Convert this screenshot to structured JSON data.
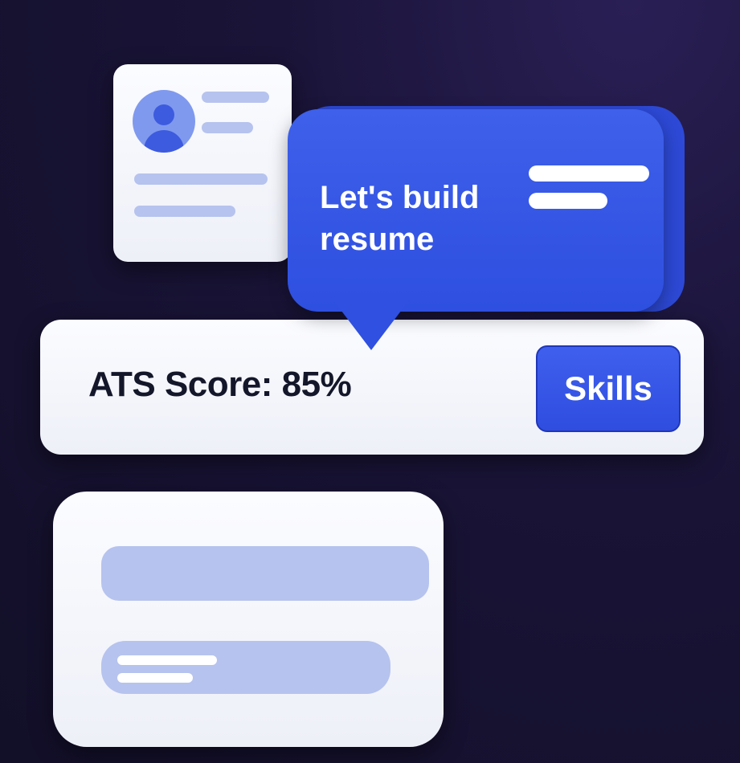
{
  "bubble": {
    "text": "Let's build resume"
  },
  "score": {
    "label": "ATS Score: 85%"
  },
  "skills_button": {
    "label": "Skills"
  },
  "colors": {
    "accent": "#3352e6",
    "skeleton": "#b6c3ee",
    "background": "#15112e"
  }
}
